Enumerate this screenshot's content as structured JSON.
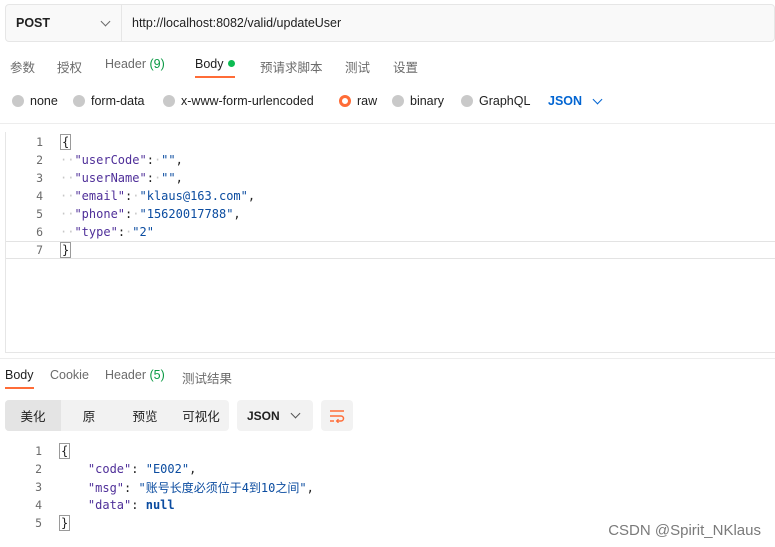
{
  "request": {
    "method": "POST",
    "url": "http://localhost:8082/valid/updateUser"
  },
  "request_tabs": [
    {
      "label": "参数"
    },
    {
      "label": "授权"
    },
    {
      "label": "Header",
      "count": "(9)"
    },
    {
      "label": "Body"
    },
    {
      "label": "预请求脚本"
    },
    {
      "label": "测试"
    },
    {
      "label": "设置"
    }
  ],
  "body_types": [
    "none",
    "form-data",
    "x-www-form-urlencoded",
    "raw",
    "binary",
    "GraphQL"
  ],
  "body_language": "JSON",
  "request_body": {
    "line_numbers": [
      "1",
      "2",
      "3",
      "4",
      "5",
      "6",
      "7"
    ],
    "open_brace": "{",
    "close_brace": "}",
    "fields": [
      {
        "key": "\"userCode\"",
        "value": "\"\"",
        "comma": ","
      },
      {
        "key": "\"userName\"",
        "value": "\"\"",
        "comma": ","
      },
      {
        "key": "\"email\"",
        "value": "\"klaus@163.com\"",
        "comma": ","
      },
      {
        "key": "\"phone\"",
        "value": "\"15620017788\"",
        "comma": ","
      },
      {
        "key": "\"type\"",
        "value": "\"2\"",
        "comma": ""
      }
    ]
  },
  "response_tabs": [
    {
      "label": "Body"
    },
    {
      "label": "Cookie"
    },
    {
      "label": "Header",
      "count": "(5)"
    },
    {
      "label": "测试结果"
    }
  ],
  "view_modes": [
    "美化",
    "原",
    "预览",
    "可视化"
  ],
  "response_format": "JSON",
  "response_body": {
    "line_numbers": [
      "1",
      "2",
      "3",
      "4",
      "5"
    ],
    "open_brace": "{",
    "close_brace": "}",
    "fields": [
      {
        "key": "\"code\"",
        "value": "\"E002\"",
        "comma": ","
      },
      {
        "key": "\"msg\"",
        "value": "\"账号长度必须位于4到10之间\"",
        "comma": ","
      },
      {
        "key": "\"data\"",
        "value": "null",
        "comma": ""
      }
    ]
  },
  "watermark": "CSDN @Spirit_NKlaus",
  "colors": {
    "accent": "#ff6c37",
    "json_link": "#0265d2",
    "active_dot": "#0cbb52",
    "json_key": "#4f2f99",
    "json_string": "#0b4ca0"
  }
}
